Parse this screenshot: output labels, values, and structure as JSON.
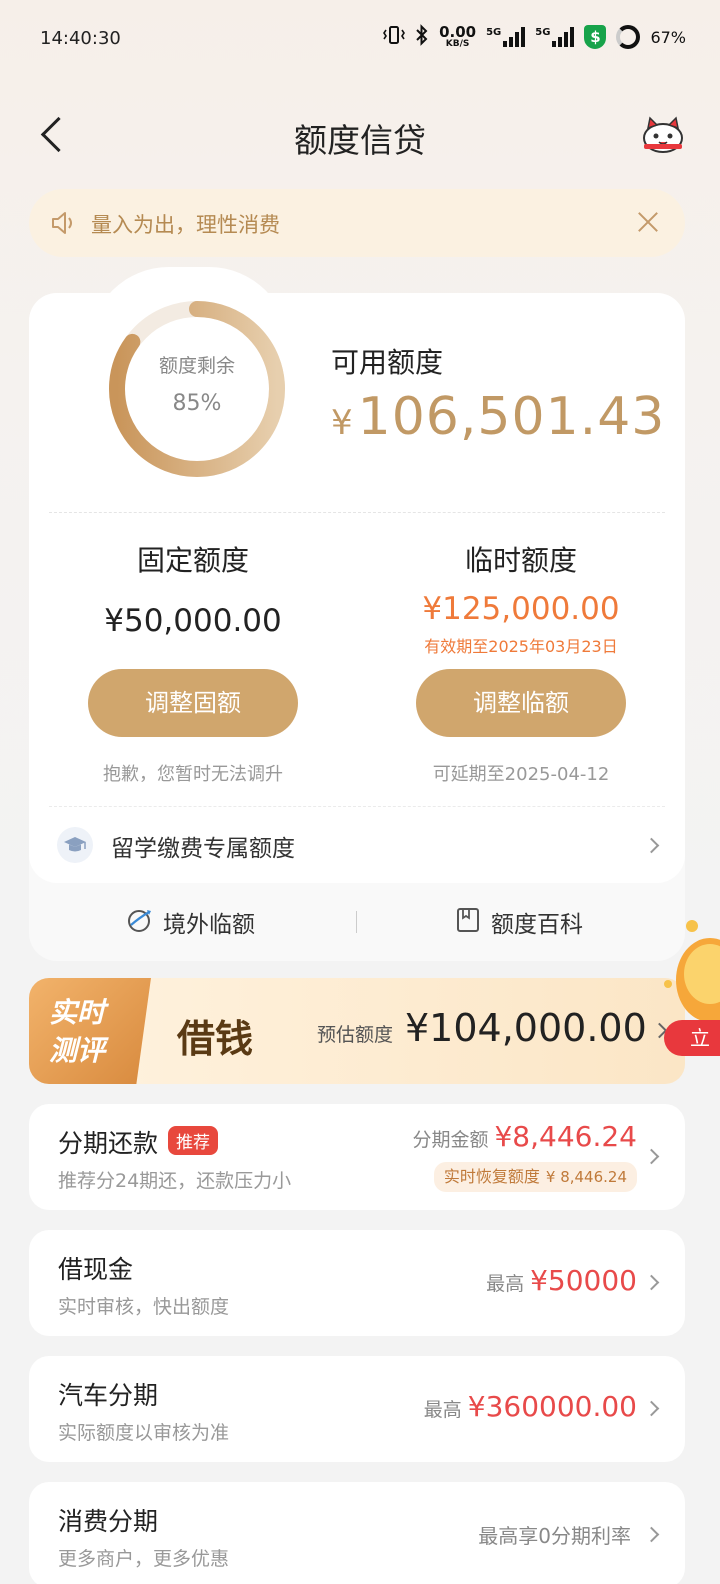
{
  "status_bar": {
    "time": "14:40:30",
    "net_speed_value": "0.00",
    "net_speed_unit": "KB/S",
    "signal1": "5G",
    "signal2": "5G",
    "battery": "67%"
  },
  "header": {
    "title": "额度信贷"
  },
  "notice": {
    "text": "量入为出，理性消费"
  },
  "credit": {
    "remaining_label": "额度剩余",
    "remaining_percent": "85%",
    "remaining_fraction": 0.85,
    "available_label": "可用额度",
    "currency": "¥",
    "available_amount": "106,501.43",
    "fixed": {
      "title": "固定额度",
      "amount": "¥50,000.00",
      "button": "调整固额",
      "note": "抱歉，您暂时无法调升"
    },
    "temporary": {
      "title": "临时额度",
      "amount": "¥125,000.00",
      "valid_until": "有效期至2025年03月23日",
      "button": "调整临额",
      "note": "可延期至2025-04-12"
    },
    "study_abroad_label": "留学缴费专属额度",
    "links": {
      "overseas": "境外临额",
      "wiki": "额度百科"
    }
  },
  "banner": {
    "tag": "实时测评",
    "title": "借钱",
    "estimate_label": "预估额度",
    "estimate_amount": "¥104,000.00",
    "float_button": "立即"
  },
  "products": [
    {
      "title": "分期还款",
      "tag": "推荐",
      "subtitle": "推荐分24期还，还款压力小",
      "right_prefix": "分期金额",
      "right_amount": "¥8,446.24",
      "chip_label": "实时恢复额度",
      "chip_amount": "¥ 8,446.24"
    },
    {
      "title": "借现金",
      "subtitle": "实时审核，快出额度",
      "right_prefix": "最高",
      "right_amount": "¥50000"
    },
    {
      "title": "汽车分期",
      "subtitle": "实际额度以审核为准",
      "right_prefix": "最高",
      "right_amount": "¥360000.00"
    },
    {
      "title": "消费分期",
      "subtitle": "更多商户，更多优惠",
      "right_text": "最高享0分期利率"
    }
  ],
  "colors": {
    "gold": "#c19965",
    "button_gold": "#d0a66d",
    "orange": "#ef7a3a",
    "red": "#e84a4a"
  }
}
